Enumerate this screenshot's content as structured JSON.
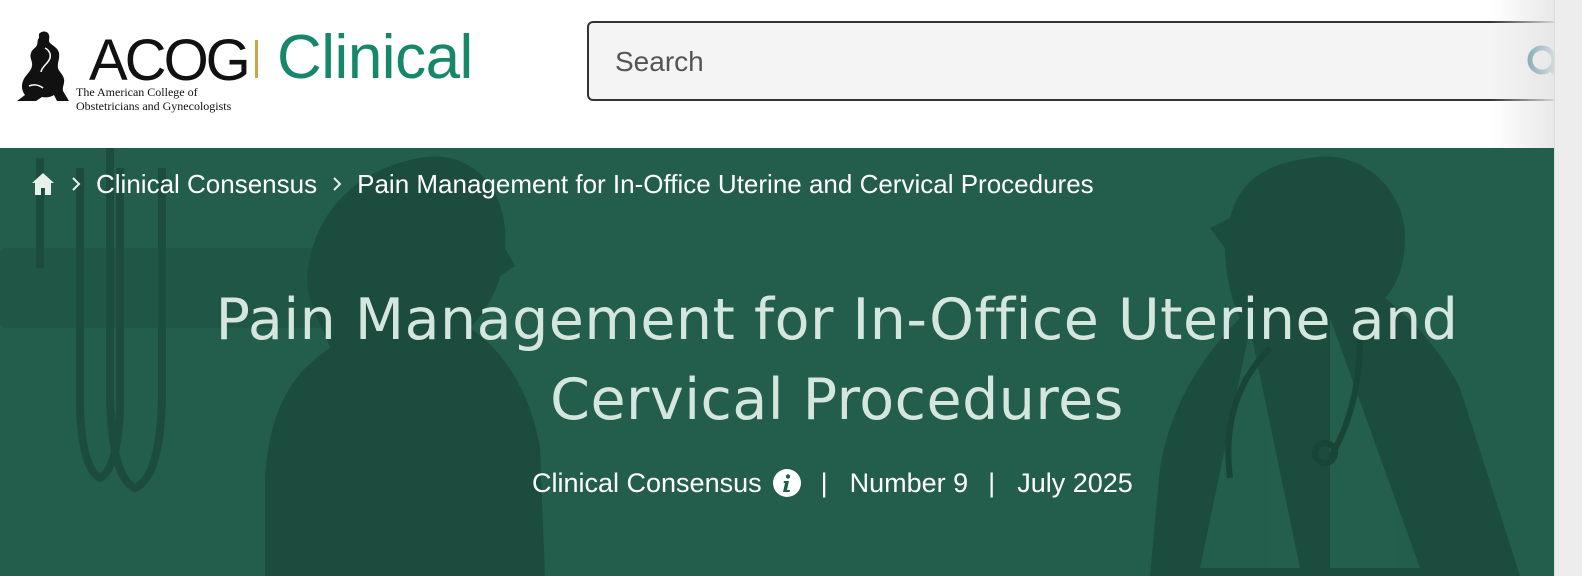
{
  "brand": {
    "acog": "ACOG",
    "subtitle_line1": "The American College of",
    "subtitle_line2": "Obstetricians and Gynecologists",
    "product": "Clinical",
    "accent_color": "#17876a",
    "divider_color": "#c9a646"
  },
  "search": {
    "placeholder": "Search",
    "icon": "search-icon"
  },
  "breadcrumb": {
    "home_icon": "home-icon",
    "items": [
      {
        "label": "Clinical Consensus"
      },
      {
        "label": "Pain Management for In-Office Uterine and Cervical Procedures"
      }
    ]
  },
  "hero": {
    "background_color": "#235e4c",
    "title": "Pain Management for In-Office Uterine and Cervical Procedures",
    "meta": {
      "type": "Clinical Consensus",
      "info_icon": "info-icon",
      "separator": "|",
      "number": "Number 9",
      "date": "July 2025"
    }
  }
}
